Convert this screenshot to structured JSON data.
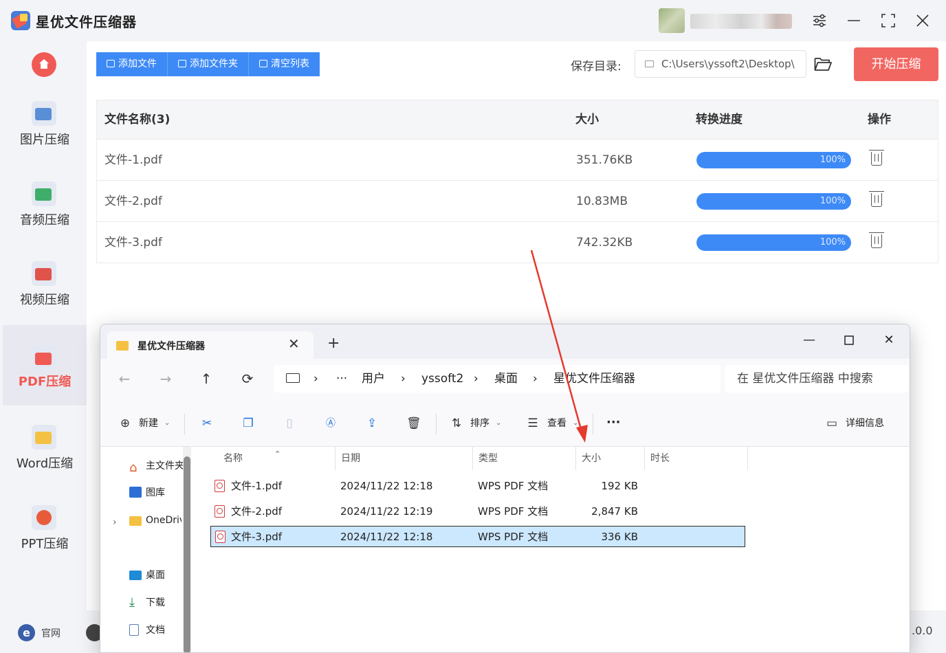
{
  "app": {
    "title": "星优文件压缩器",
    "user_name": "████████"
  },
  "sidebar": {
    "items": [
      {
        "label": "图片压缩",
        "icon": "image-icon",
        "color": "#5a8fd8"
      },
      {
        "label": "音频压缩",
        "icon": "music-icon",
        "color": "#3fae6a"
      },
      {
        "label": "视频压缩",
        "icon": "video-icon",
        "color": "#e0534a"
      },
      {
        "label": "PDF压缩",
        "icon": "pdf-icon",
        "color": "#f05a55"
      },
      {
        "label": "Word压缩",
        "icon": "word-icon",
        "color": "#f5c143"
      },
      {
        "label": "PPT压缩",
        "icon": "ppt-icon",
        "color": "#e85b3a"
      }
    ],
    "active": "PDF压缩"
  },
  "toolbar": {
    "add_file": "添加文件",
    "add_folder": "添加文件夹",
    "clear_list": "清空列表",
    "save_dir_label": "保存目录:",
    "save_dir_value": "C:\\Users\\yssoft2\\Desktop\\",
    "start_button": "开始压缩"
  },
  "table": {
    "headers": {
      "name": "文件名称(3)",
      "size": "大小",
      "progress": "转换进度",
      "action": "操作"
    },
    "rows": [
      {
        "name": "文件-1.pdf",
        "size": "351.76KB",
        "progress": 100,
        "progress_label": "100%"
      },
      {
        "name": "文件-2.pdf",
        "size": "10.83MB",
        "progress": 100,
        "progress_label": "100%"
      },
      {
        "name": "文件-3.pdf",
        "size": "742.32KB",
        "progress": 100,
        "progress_label": "100%"
      }
    ]
  },
  "footer": {
    "website": "官网",
    "version": ".0.0"
  },
  "explorer": {
    "tab_title": "星优文件压缩器",
    "breadcrumb": [
      "用户",
      "yssoft2",
      "桌面",
      "星优文件压缩器"
    ],
    "search_placeholder": "在 星优文件压缩器 中搜索",
    "commands": {
      "new": "新建",
      "sort": "排序",
      "view": "查看",
      "details": "详细信息"
    },
    "nav_pane": [
      {
        "label": "主文件夹",
        "icon": "home-icon"
      },
      {
        "label": "图库",
        "icon": "gallery-icon"
      },
      {
        "label": "OneDrive",
        "icon": "folder-icon"
      },
      {
        "label": "桌面",
        "icon": "desktop-icon"
      },
      {
        "label": "下载",
        "icon": "download-icon"
      },
      {
        "label": "文档",
        "icon": "document-icon"
      }
    ],
    "columns": {
      "name": "名称",
      "date": "日期",
      "type": "类型",
      "size": "大小",
      "duration": "时长"
    },
    "files": [
      {
        "name": "文件-1.pdf",
        "date": "2024/11/22 12:18",
        "type": "WPS PDF 文档",
        "size": "192 KB",
        "selected": false
      },
      {
        "name": "文件-2.pdf",
        "date": "2024/11/22 12:19",
        "type": "WPS PDF 文档",
        "size": "2,847 KB",
        "selected": false
      },
      {
        "name": "文件-3.pdf",
        "date": "2024/11/22 12:18",
        "type": "WPS PDF 文档",
        "size": "336 KB",
        "selected": true
      }
    ]
  },
  "colors": {
    "accent_blue": "#3d8af7",
    "accent_red": "#f26661",
    "selection": "#cce8ff",
    "arrow": "#e53a2e"
  }
}
